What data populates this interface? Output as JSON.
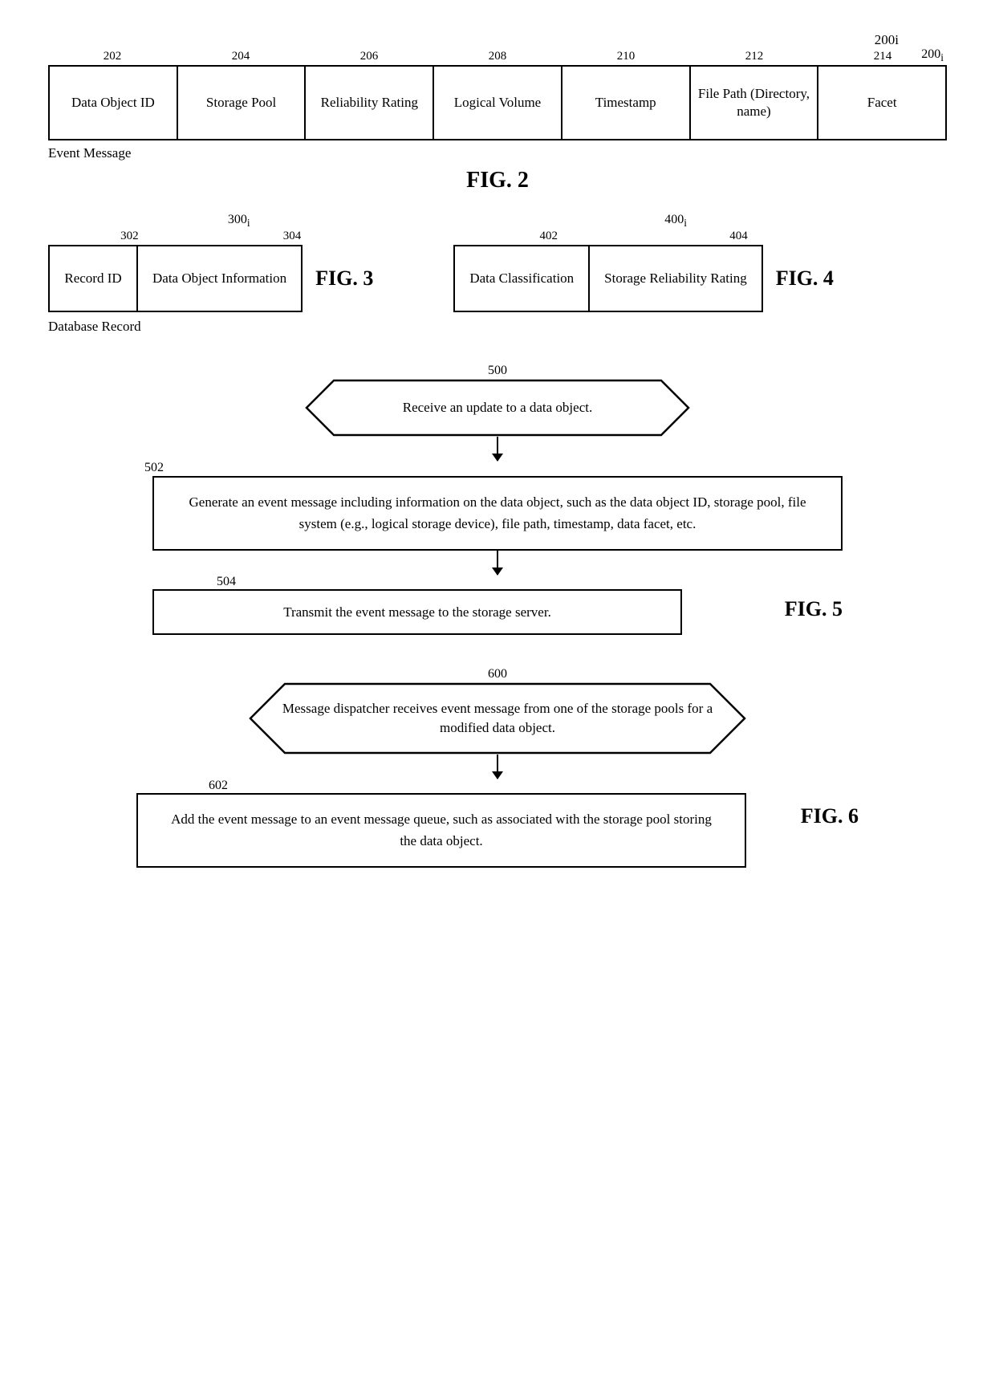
{
  "fig2": {
    "ref_main": "200i",
    "col_numbers": [
      "202",
      "204",
      "206",
      "208",
      "210",
      "212",
      "214"
    ],
    "col_labels": [
      "Data Object ID",
      "Storage Pool",
      "Reliability Rating",
      "Logical Volume",
      "Timestamp",
      "File Path (Directory, name)",
      "Facet"
    ],
    "event_msg": "Event Message",
    "title": "FIG. 2"
  },
  "fig3": {
    "ref_main": "300i",
    "col_numbers": [
      "302",
      "304"
    ],
    "col_labels": [
      "Record ID",
      "Data Object Information"
    ],
    "title": "FIG. 3"
  },
  "fig4": {
    "ref_main": "400i",
    "col_numbers": [
      "402",
      "404"
    ],
    "col_labels": [
      "Data Classification",
      "Storage Reliability Rating"
    ],
    "title": "FIG. 4"
  },
  "database_record": "Database Record",
  "fig5": {
    "title": "FIG. 5",
    "nodes": [
      {
        "id": "500",
        "type": "diamond",
        "text": "Receive an update to a data object."
      },
      {
        "id": "502",
        "type": "rect",
        "text": "Generate an event message including information on the data object, such as the data object ID, storage pool, file system (e.g., logical storage device), file path, timestamp, data facet, etc."
      },
      {
        "id": "504",
        "type": "rect",
        "text": "Transmit the event message to the storage server."
      }
    ]
  },
  "fig6": {
    "title": "FIG. 6",
    "nodes": [
      {
        "id": "600",
        "type": "diamond",
        "text": "Message dispatcher receives event message from one of the storage pools for a modified data object."
      },
      {
        "id": "602",
        "type": "rect",
        "text": "Add the event message to an event message queue, such as associated with the storage pool storing the data object."
      }
    ]
  }
}
